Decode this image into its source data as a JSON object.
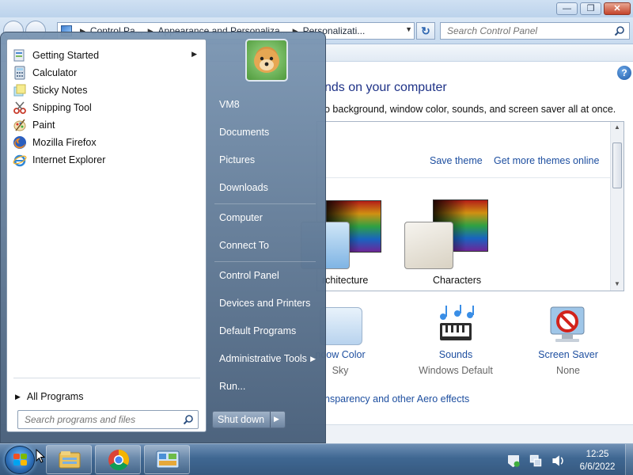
{
  "control_panel": {
    "breadcrumb": [
      "Control Pa...",
      "Appearance and Personaliza...",
      "Personalizati..."
    ],
    "search_placeholder": "Search Control Panel",
    "heading": "nds on your computer",
    "description": "o background, window color, sounds, and screen saver all at once.",
    "save_theme": "Save theme",
    "more_themes": "Get more themes online",
    "themes": [
      {
        "label": "Architecture",
        "visible_text": "rchitecture"
      },
      {
        "label": "Characters",
        "visible_text": "Characters"
      }
    ],
    "bottom_items": [
      {
        "title": "ndow Color",
        "value": "Sky"
      },
      {
        "title": "Sounds",
        "value": "Windows Default"
      },
      {
        "title": "Screen Saver",
        "value": "None"
      }
    ],
    "aero_link": "nsparency and other Aero effects",
    "help_label": "?"
  },
  "start_menu": {
    "programs": [
      {
        "label": "Getting Started",
        "icon": "getting-started-icon",
        "has_submenu": true
      },
      {
        "label": "Calculator",
        "icon": "calculator-icon"
      },
      {
        "label": "Sticky Notes",
        "icon": "sticky-notes-icon"
      },
      {
        "label": "Snipping Tool",
        "icon": "snipping-tool-icon"
      },
      {
        "label": "Paint",
        "icon": "paint-icon"
      },
      {
        "label": "Mozilla Firefox",
        "icon": "firefox-icon"
      },
      {
        "label": "Internet Explorer",
        "icon": "internet-explorer-icon"
      }
    ],
    "all_programs": "All Programs",
    "search_placeholder": "Search programs and files",
    "right_items": [
      {
        "label": "VM8"
      },
      {
        "label": "Documents"
      },
      {
        "label": "Pictures"
      },
      {
        "label": "Downloads"
      },
      {
        "label": "Computer"
      },
      {
        "label": "Connect To"
      },
      {
        "label": "Control Panel"
      },
      {
        "label": "Devices and Printers"
      },
      {
        "label": "Default Programs"
      },
      {
        "label": "Administrative Tools",
        "has_submenu": true
      },
      {
        "label": "Run..."
      }
    ],
    "shutdown_label": "Shut down"
  },
  "taskbar": {
    "apps": [
      "windows-explorer-icon",
      "chrome-icon",
      "control-panel-icon"
    ],
    "time": "12:25",
    "date": "6/6/2022"
  },
  "colors": {
    "link": "#1e4fa0",
    "heading": "#1e3287",
    "taskbar": "#3f6792"
  }
}
